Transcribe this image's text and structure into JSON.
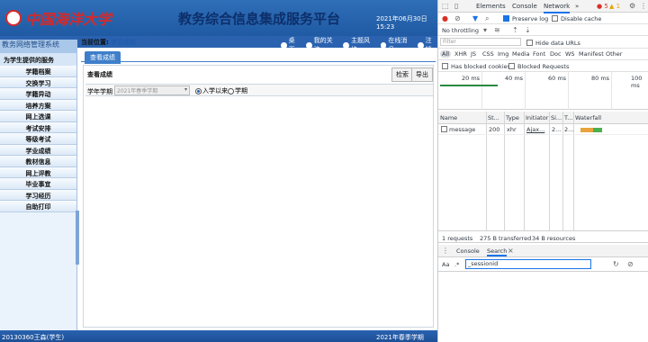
{
  "banner": {
    "logo_text": "中国海洋大学",
    "site_title": "教务综合信息集成服务平台",
    "date": "2021年06月30日 15:23"
  },
  "header": {
    "system_name": "教务网络管理系统",
    "crumb_label": "当前位置:",
    "crumb_value": "学业成绩",
    "toolbar": [
      "桌面",
      "我的关注",
      "主题风格",
      "在线消息",
      "注销"
    ]
  },
  "sidebar": {
    "section": "为学生提供的服务",
    "items": [
      "学籍档案",
      "交换学习",
      "学籍异动",
      "培养方案",
      "网上选课",
      "考试安排",
      "等级考试",
      "学业成绩",
      "教材信息",
      "网上评教",
      "毕业事宜",
      "学习经历",
      "自助打印"
    ]
  },
  "content": {
    "tab": "查看成绩",
    "panel_title": "查看成绩",
    "btn_search": "检索",
    "btn_export": "导出",
    "year_label": "学年学期",
    "year_value": "2021年春季学期",
    "radio_all": "入学以来",
    "radio_term": "学期"
  },
  "status": {
    "left": "20130360王森(学生)",
    "right": "2021年春季学期"
  },
  "devtools": {
    "tabs": [
      "Elements",
      "Console",
      "Network",
      "»"
    ],
    "error_count": "5",
    "warn_count": "1",
    "preserve_log": "Preserve log",
    "disable_cache": "Disable cache",
    "throttle": "No throttling",
    "filter_placeholder": "Filter",
    "hide_data_urls": "Hide data URLs",
    "types": [
      "All",
      "XHR",
      "JS",
      "CSS",
      "Img",
      "Media",
      "Font",
      "Doc",
      "WS",
      "Manifest",
      "Other"
    ],
    "has_blocked_cookies": "Has blocked cookies",
    "blocked_requests": "Blocked Requests",
    "timeline_labels": [
      "20 ms",
      "40 ms",
      "60 ms",
      "80 ms",
      "100 ms"
    ],
    "columns": [
      "Name",
      "St...",
      "Type",
      "Initiator",
      "Si...",
      "T...",
      "Waterfall"
    ],
    "row": {
      "name": "message",
      "status": "200",
      "type": "xhr",
      "initiator": "Ajax...",
      "size": "2...",
      "time": "2..."
    },
    "summary": [
      "1 requests",
      "275 B transferred",
      "34 B resources"
    ],
    "drawer_tabs": [
      "Console",
      "Search"
    ],
    "search_value": "_sessionid",
    "match_case": "Aa",
    "regex": ".*"
  }
}
